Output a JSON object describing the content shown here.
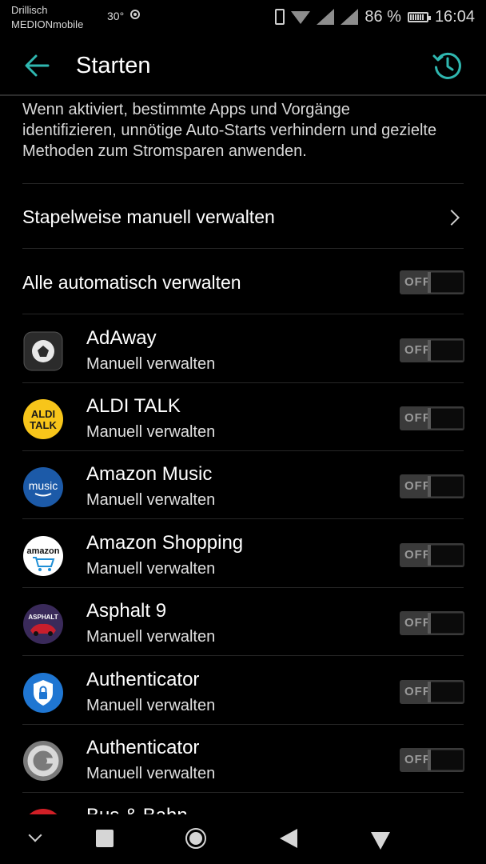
{
  "status_bar": {
    "carrier_line1": "Drillisch",
    "carrier_line2": "MEDIONmobile",
    "temperature": "30°",
    "battery_percent": "86 %",
    "time": "16:04"
  },
  "toolbar": {
    "title": "Starten",
    "back_icon": "arrow-left-icon",
    "history_icon": "clock-history-icon",
    "accent_color": "#2fb7b0"
  },
  "description": "Wenn aktiviert, bestimmte Apps und Vorgänge identifizieren, unnötige Auto-Starts verhindern und gezielte Methoden zum Stromsparen anwenden.",
  "batch_manage": {
    "label": "Stapelweise manuell verwalten"
  },
  "auto_manage": {
    "label": "Alle automatisch verwalten",
    "toggle": "OFF"
  },
  "apps": [
    {
      "name": "AdAway",
      "subtitle": "Manuell verwalten",
      "toggle": "OFF",
      "icon": "adaway-icon"
    },
    {
      "name": "ALDI TALK",
      "subtitle": "Manuell verwalten",
      "toggle": "OFF",
      "icon": "aldi-talk-icon",
      "icon_text": "ALDI\nTALK"
    },
    {
      "name": "Amazon Music",
      "subtitle": "Manuell verwalten",
      "toggle": "OFF",
      "icon": "amazon-music-icon",
      "icon_text": "music"
    },
    {
      "name": "Amazon Shopping",
      "subtitle": "Manuell verwalten",
      "toggle": "OFF",
      "icon": "amazon-shopping-icon",
      "icon_text": "amazon"
    },
    {
      "name": "Asphalt 9",
      "subtitle": "Manuell verwalten",
      "toggle": "OFF",
      "icon": "asphalt-9-icon",
      "icon_text": "ASPHALT"
    },
    {
      "name": "Authenticator",
      "subtitle": "Manuell verwalten",
      "toggle": "OFF",
      "icon": "microsoft-authenticator-icon"
    },
    {
      "name": "Authenticator",
      "subtitle": "Manuell verwalten",
      "toggle": "OFF",
      "icon": "google-authenticator-icon"
    },
    {
      "name": "Bus & Bahn",
      "partially_visible": true,
      "icon": "bus-bahn-icon"
    }
  ],
  "nav_bar": {
    "icons": [
      "chevron-down-icon",
      "recents-square-icon",
      "home-circle-icon",
      "back-triangle-icon",
      "notifications-triangle-icon"
    ]
  }
}
